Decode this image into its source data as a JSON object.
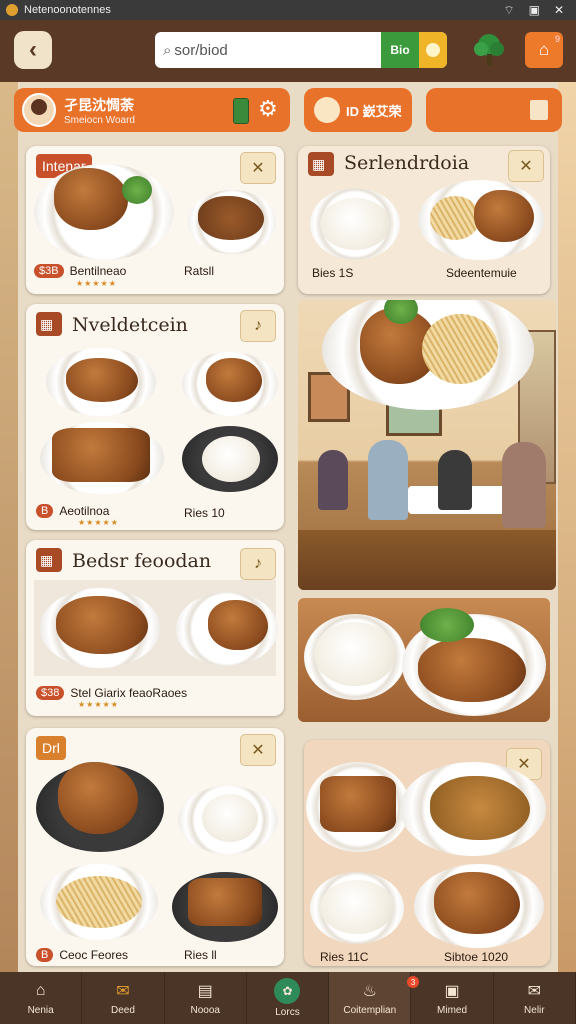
{
  "status_bar": {
    "app_title": "Netenoonotennes",
    "icons": [
      "wifi-icon",
      "window-icon",
      "close-icon"
    ]
  },
  "header": {
    "search": {
      "value": "sor/biod",
      "go_label": "Bio"
    },
    "cart_count": "9"
  },
  "profile": {
    "name": "孑昆沈惆荼",
    "subtitle": "Smeiocn Woard"
  },
  "chip": {
    "label": "ID 嶔艾荣"
  },
  "cards": [
    {
      "tag": "Intenar",
      "title": "",
      "price": "$3B",
      "name": "Bentilneao",
      "count": "Ratsll"
    },
    {
      "tag": "",
      "title": "Serlendrdoia",
      "price": "",
      "name": "Sdeentemuie",
      "count": "Bies 1S"
    },
    {
      "tag": "",
      "title": "Nveldetcein",
      "price": "B",
      "name": "Aeotilnoa",
      "count": "Ries 10"
    },
    {
      "tag": "",
      "title": "Bedsr feoodan",
      "price": "$38",
      "name": "Stel Giarix feaoRaoes",
      "count": ""
    },
    {
      "tag": "Drl",
      "title": "",
      "price": "B",
      "name": "Ceoc Feores",
      "count": "Ries ll"
    },
    {
      "tag": "",
      "title": "",
      "price": "",
      "name": "Sibtoe 1020",
      "count": "Ries 11C"
    }
  ],
  "nav": [
    {
      "label": "Nenia",
      "icon": "home-icon"
    },
    {
      "label": "Deed",
      "icon": "envelope-icon"
    },
    {
      "label": "Noooa",
      "icon": "book-icon"
    },
    {
      "label": "Lorcs",
      "icon": "leaf-icon"
    },
    {
      "label": "Coitemplian",
      "icon": "chef-icon",
      "badge": "3"
    },
    {
      "label": "Mimed",
      "icon": "bag-icon"
    },
    {
      "label": "Nelir",
      "icon": "mail-icon"
    }
  ],
  "colors": {
    "accent": "#e9722b",
    "header": "#5a3a26",
    "nav": "#4a3526",
    "card": "#fbf7ef"
  }
}
